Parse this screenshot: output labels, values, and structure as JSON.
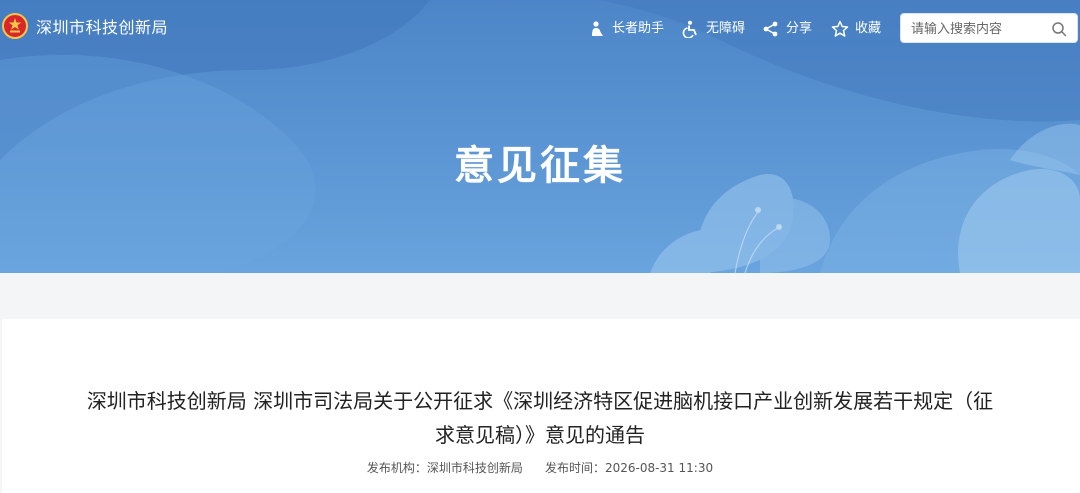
{
  "header": {
    "site_name": "深圳市科技创新局",
    "nav": {
      "elder": "长者助手",
      "accessibility": "无障碍",
      "share": "分享",
      "favorite": "收藏"
    },
    "search": {
      "placeholder": "请输入搜索内容",
      "value": ""
    },
    "icons": [
      "emblem-icon",
      "elder-icon",
      "accessibility-icon",
      "share-icon",
      "star-icon",
      "search-icon"
    ]
  },
  "banner": {
    "title": "意见征集"
  },
  "article": {
    "title": "深圳市科技创新局 深圳市司法局关于公开征求《深圳经济特区促进脑机接口产业创新发展若干规定（征求意见稿）》意见的通告",
    "publisher_label": "发布机构：",
    "publisher": "深圳市科技创新局",
    "time_label": "发布时间：",
    "time": "2026-08-31 11:30"
  },
  "colors": {
    "banner": "#5b95d3",
    "text_dark": "#222222",
    "meta_text": "#555555",
    "page_bg": "#f4f5f7"
  }
}
